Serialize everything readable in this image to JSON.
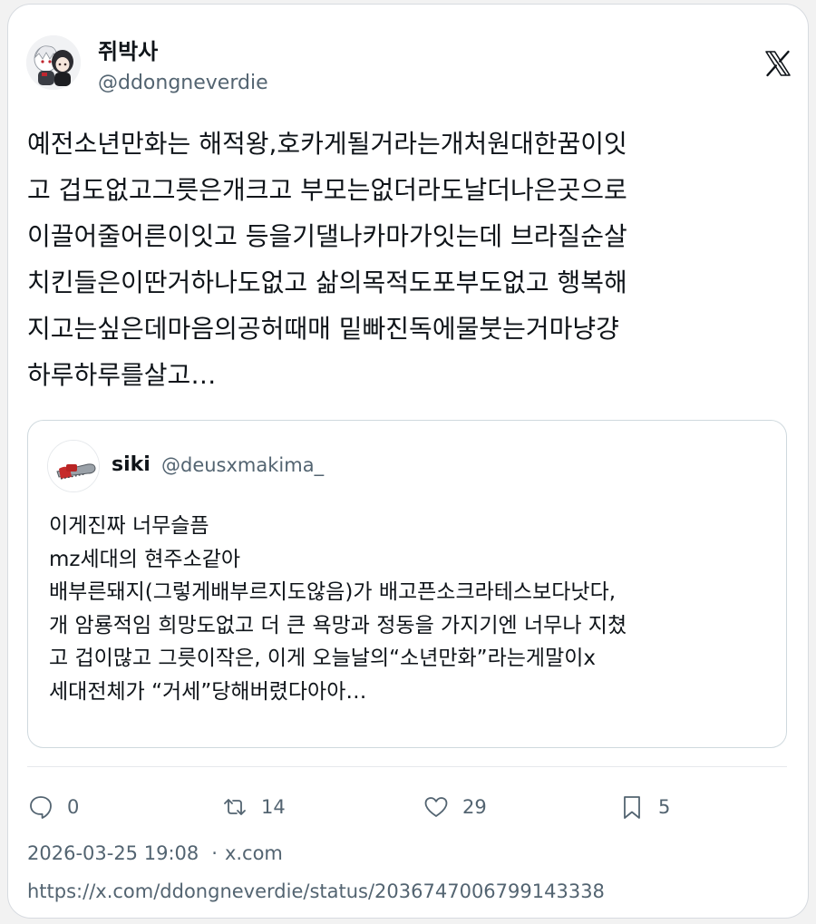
{
  "author": {
    "display_name": "쥐박사",
    "handle": "@ddongneverdie",
    "avatar_icon": "anime-avatar-pair"
  },
  "brand_icon": "x-logo-icon",
  "tweet_text_lines": [
    "예전소년만화는 해적왕,호카게될거라는개처원대한꿈이잇",
    "고 겁도없고그릇은개크고 부모는없더라도날더나은곳으로",
    "이끌어줄어른이잇고 등을기댈나카마가잇는데 브라질순살",
    "치킨들은이딴거하나도없고 삶의목적도포부도없고 행복해",
    "지고는싶은데마음의공허때매 밑빠진독에물붓는거마냥걍",
    "하루하루를살고…"
  ],
  "quoted": {
    "display_name": "siki",
    "handle": "@deusxmakima_",
    "avatar_icon": "chainsaw-avatar",
    "text_lines": [
      "이게진짜 너무슬픔",
      "mz세대의 현주소같아",
      "배부른돼지(그렇게배부르지도않음)가 배고픈소크라테스보다낫다,",
      "개 암룡적임 희망도없고 더 큰 욕망과 정동을 가지기엔 너무나 지쳤",
      "고 겁이많고 그릇이작은, 이게 오늘날의“소년만화”라는게말이x",
      "세대전체가 “거세”당해버렸다아아…"
    ]
  },
  "actions": {
    "reply_count": "0",
    "retweet_count": "14",
    "like_count": "29",
    "bookmark_count": "5"
  },
  "meta": {
    "timestamp": "2026-03-25 19:08",
    "separator": "·",
    "source": "x.com",
    "url": "https://x.com/ddongneverdie/status/2036747006799143338"
  },
  "colors": {
    "text": "#0f1419",
    "muted": "#536471",
    "border": "#cfd9de",
    "background": "#ffffff"
  }
}
